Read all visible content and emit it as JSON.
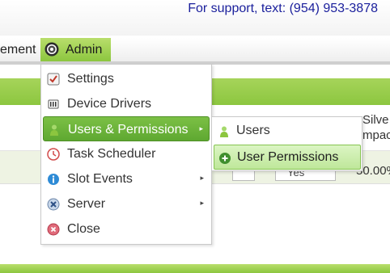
{
  "header": {
    "support_text": "For support, text: (954) 953-3878"
  },
  "nav": {
    "partial_item": "ement",
    "admin_label": "Admin"
  },
  "background": {
    "column_header_line1": "Silve",
    "column_header_line2": "mpac",
    "row_select_value": "Yes",
    "row_percent": "50.00%"
  },
  "menu": {
    "items": [
      {
        "label": "Settings",
        "icon": "settings-checkbox-icon"
      },
      {
        "label": "Device Drivers",
        "icon": "device-driver-icon"
      },
      {
        "label": "Users & Permissions",
        "icon": "user-icon",
        "arrow": "▸"
      },
      {
        "label": "Task Scheduler",
        "icon": "clock-icon"
      },
      {
        "label": "Slot Events",
        "icon": "info-icon",
        "arrow": "▸"
      },
      {
        "label": "Server",
        "icon": "server-icon",
        "arrow": "▸"
      },
      {
        "label": "Close",
        "icon": "close-icon"
      }
    ]
  },
  "submenu": {
    "items": [
      {
        "label": "Users",
        "icon": "user-icon"
      },
      {
        "label": "User Permissions",
        "icon": "add-icon"
      }
    ]
  },
  "colors": {
    "accent_green": "#8cc63f",
    "active_green": "#5ea831",
    "support_blue": "#1a1f9c"
  }
}
